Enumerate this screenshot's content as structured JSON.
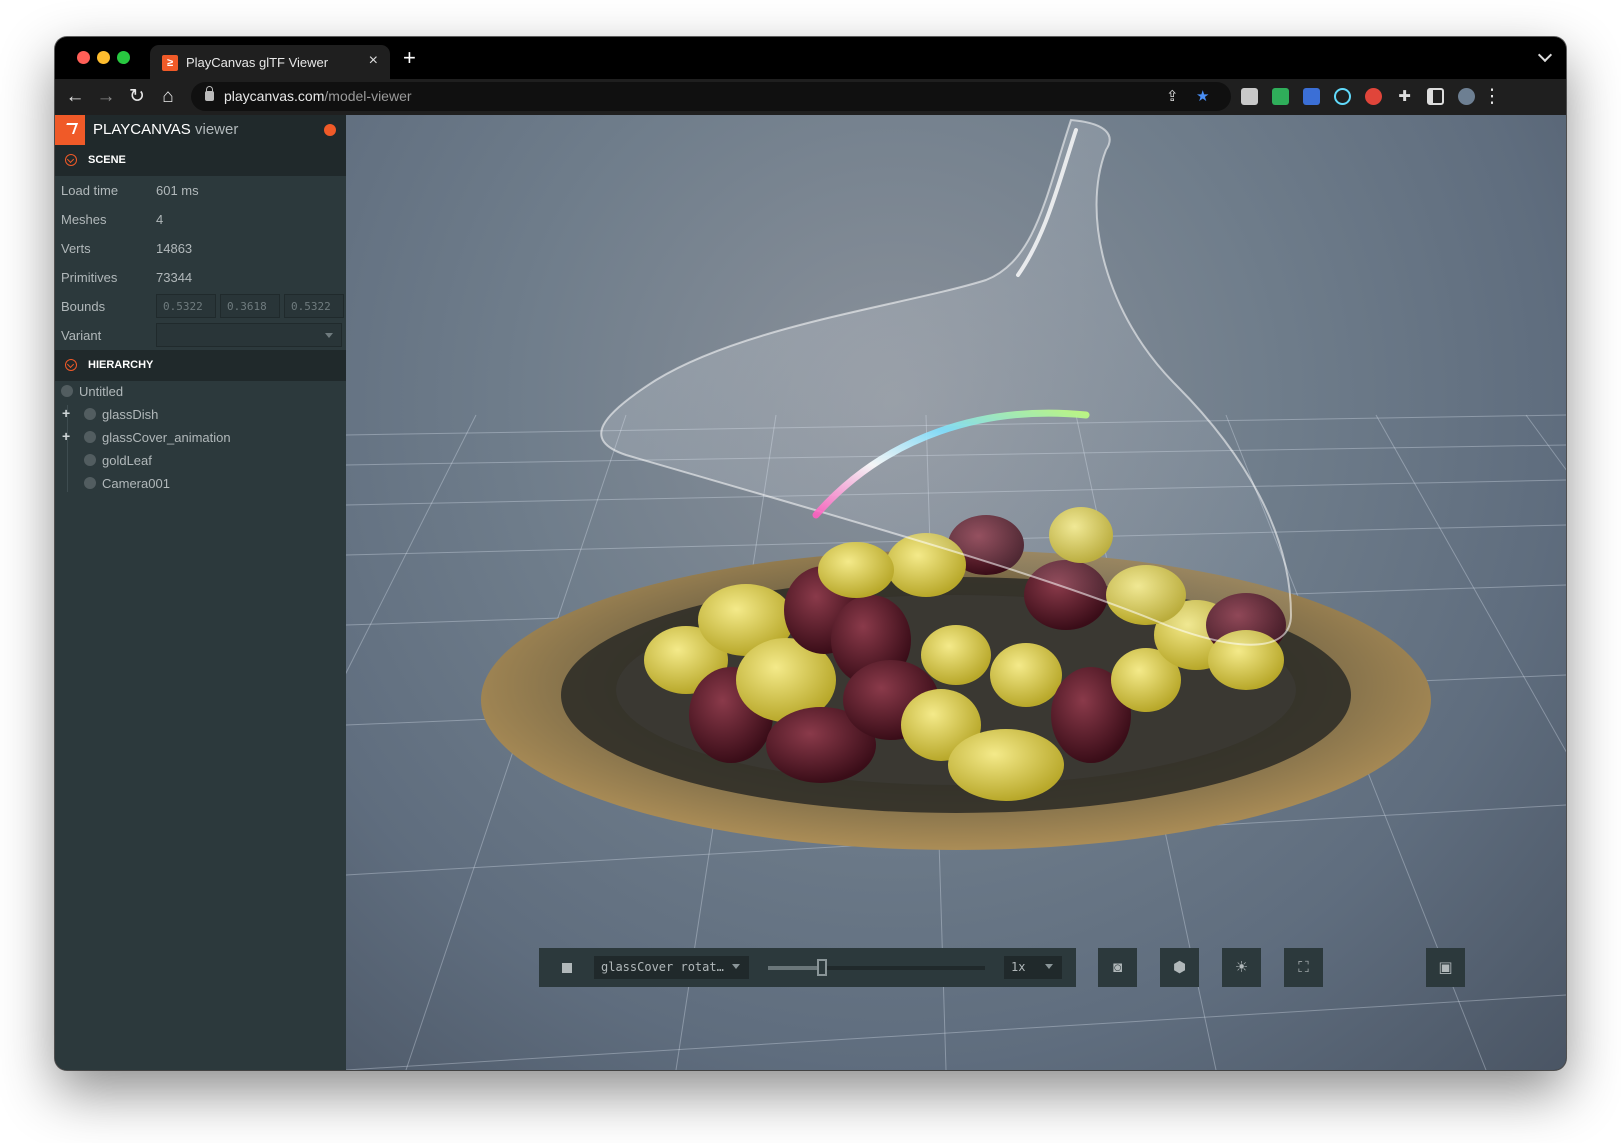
{
  "browser": {
    "tab_title": "PlayCanvas glTF Viewer",
    "tab_favicon": "playcanvas-logo-icon",
    "tab_close": "×",
    "new_tab": "+",
    "url_host": "playcanvas.com",
    "url_path": "/model-viewer",
    "nav": {
      "back": "←",
      "forward": "→",
      "reload": "↻",
      "home": "⌂"
    },
    "menu": "⋮"
  },
  "panel": {
    "brand": "PLAYCANVAS",
    "brand_sub": "viewer",
    "scene": {
      "header": "SCENE",
      "rows": [
        {
          "label": "Load time",
          "value": "601 ms"
        },
        {
          "label": "Meshes",
          "value": "4"
        },
        {
          "label": "Verts",
          "value": "14863"
        },
        {
          "label": "Primitives",
          "value": "73344"
        }
      ],
      "bounds_label": "Bounds",
      "bounds": [
        "0.5322",
        "0.3618",
        "0.5322"
      ],
      "variant_label": "Variant",
      "variant_value": ""
    },
    "hierarchy": {
      "header": "HIERARCHY",
      "root": "Untitled",
      "children": [
        {
          "name": "glassDish",
          "expandable": true
        },
        {
          "name": "glassCover_animation",
          "expandable": true
        },
        {
          "name": "goldLeaf",
          "expandable": false
        },
        {
          "name": "Camera001",
          "expandable": false
        }
      ],
      "expand_glyph": "+"
    }
  },
  "animation": {
    "track": "glassCover rotat…",
    "speed": "1x",
    "progress": 0.25
  },
  "viewport_buttons": [
    "camera-icon",
    "cube-icon",
    "light-icon",
    "fullscreen-icon",
    "screenshot-icon"
  ],
  "colors": {
    "accent": "#f05a28",
    "panel_bg": "#2c393c",
    "panel_header_bg": "#20292b"
  }
}
